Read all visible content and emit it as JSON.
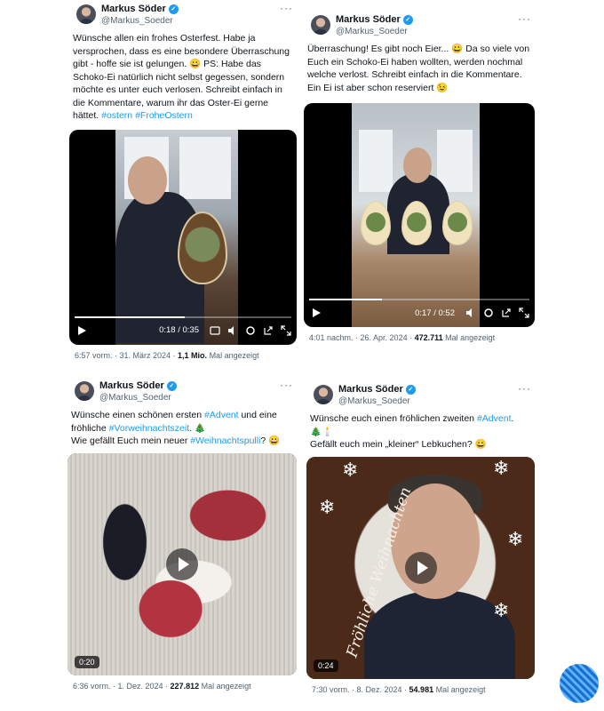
{
  "user": {
    "name": "Markus Söder",
    "handle": "@Markus_Soeder",
    "verified_mark": "✓",
    "more": "···"
  },
  "tweets": [
    {
      "text_before": "Wünsche allen ein frohes Osterfest. Habe ja versprochen, dass es eine besondere Überraschung gibt - hoffe sie ist gelungen. 😀 PS: Habe das Schoko-Ei natürlich nicht selbst gegessen, sondern möchte es unter euch verlosen. Schreibt einfach in die Kommentare, warum ihr das Oster-Ei gerne hättet. ",
      "hashtags": [
        "#ostern",
        "#FroheOstern"
      ],
      "video_time": "0:18 / 0:35",
      "video_progress": 0.51,
      "date": "6:57 vorm. · 31. März 2024 · ",
      "views": "1,1 Mio.",
      "views_label": " Mal angezeigt"
    },
    {
      "text_before": "Überraschung! Es gibt noch Eier... 😀 Da so viele von Euch ein Schoko-Ei haben wollten, werden nochmal welche verlost. Schreibt einfach in die Kommentare. Ein Ei ist aber schon reserviert 😉",
      "video_time": "0:17 / 0:52",
      "video_progress": 0.33,
      "date": "4:01 nachm. · 26. Apr. 2024 · ",
      "views": "472.711",
      "views_label": " Mal angezeigt"
    },
    {
      "line1_a": "Wünsche einen schönen ersten ",
      "line1_tag": "#Advent",
      "line1_b": " und eine fröhliche ",
      "line1_tag2": "#Vorweihnachtszeit",
      "line1_c": ". 🎄",
      "line2_a": "Wie gefällt Euch mein neuer ",
      "line2_tag": "#Weihnachtspulli",
      "line2_b": "? 😀",
      "duration": "0:20",
      "date": "6:36 vorm. · 1. Dez. 2024 · ",
      "views": "227.812",
      "views_label": " Mal angezeigt"
    },
    {
      "line1_a": "Wünsche euch einen fröhlichen zweiten ",
      "line1_tag": "#Advent",
      "line1_b": ".",
      "line2": "🎄🕯️",
      "line3": "Gefällt euch mein „kleiner“ Lebkuchen? 😀",
      "duration": "0:24",
      "cake_text": "Fröhliche Weihnachten",
      "date": "7:30 vorm. · 8. Dez. 2024 · ",
      "views": "54.981",
      "views_label": " Mal angezeigt"
    }
  ],
  "icons": [
    "play-icon",
    "cc-icon",
    "volume-icon",
    "settings-icon",
    "share-icon",
    "fullscreen-icon",
    "verified-icon",
    "more-icon"
  ]
}
